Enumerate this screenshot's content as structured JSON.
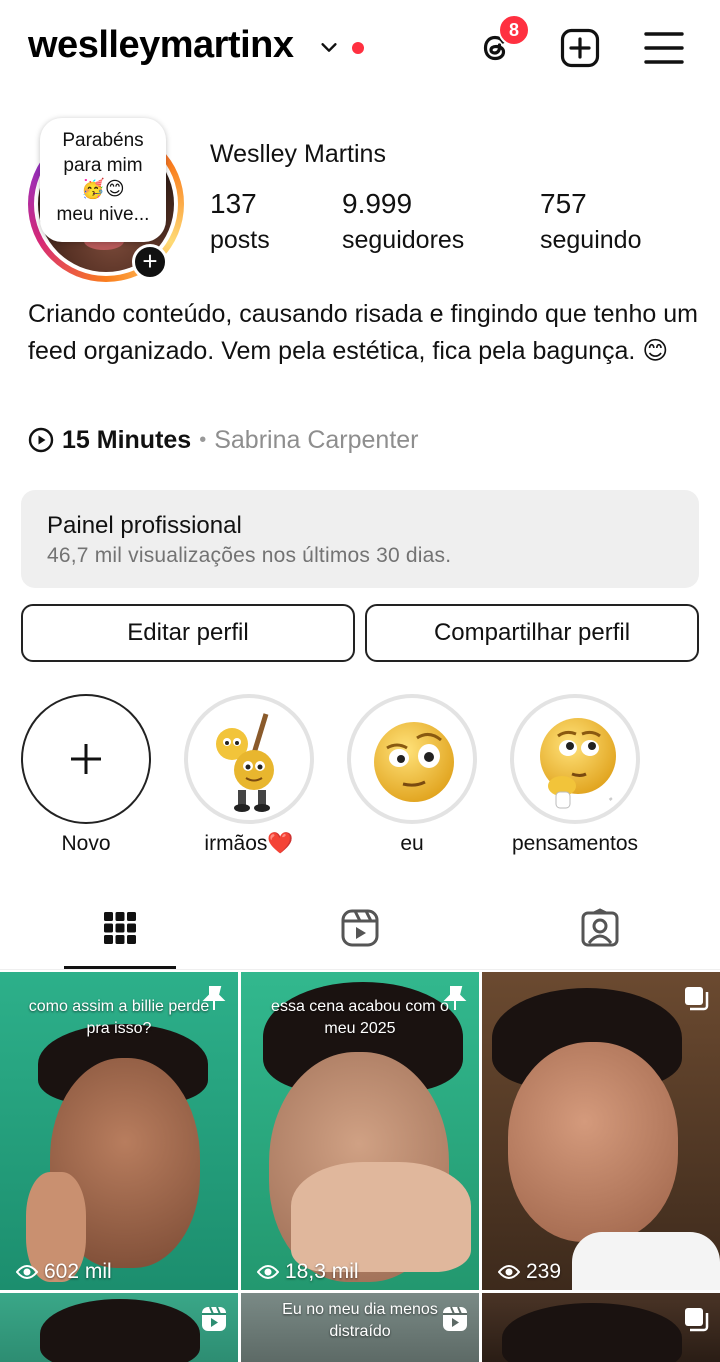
{
  "header": {
    "username": "weslleymartinx",
    "notifications_count": "8"
  },
  "profile": {
    "note": {
      "line1": "Parabéns",
      "line2": "para mim",
      "emojis": "🥳😊",
      "line3": "meu nive..."
    },
    "full_name": "Weslley Martins",
    "stats": [
      {
        "value": "137",
        "label": "posts"
      },
      {
        "value": "9.999",
        "label": "seguidores"
      },
      {
        "value": "757",
        "label": "seguindo"
      }
    ],
    "bio": "Criando conteúdo, causando risada e fingindo que tenho um feed organizado. Vem pela estética, fica pela bagunça. 😊",
    "music": {
      "title": "15 Minutes",
      "separator": "•",
      "artist": "Sabrina Carpenter"
    }
  },
  "professional_panel": {
    "title": "Painel profissional",
    "subtitle": "46,7 mil visualizações nos últimos 30 dias."
  },
  "buttons": {
    "edit": "Editar perfil",
    "share": "Compartilhar perfil"
  },
  "highlights": [
    {
      "label": "Novo"
    },
    {
      "label": "irmãos❤️"
    },
    {
      "label": "eu"
    },
    {
      "label": "pensamentos"
    }
  ],
  "tabs": [
    {
      "icon": "grid-icon"
    },
    {
      "icon": "reels-icon"
    },
    {
      "icon": "tagged-icon"
    }
  ],
  "posts": [
    {
      "caption": "como assim a billie perde pra isso?",
      "views": "602 mil",
      "icon": "pin-icon"
    },
    {
      "caption": "essa cena acabou com o meu 2025",
      "views": "18,3 mil",
      "icon": "pin-icon"
    },
    {
      "caption": "",
      "views": "239",
      "icon": "carousel-icon"
    },
    {
      "caption": "",
      "views": "",
      "icon": "reels-icon"
    },
    {
      "caption": "Eu no meu dia menos distraído",
      "views": "",
      "icon": "reels-icon"
    },
    {
      "caption": "",
      "views": "",
      "icon": "carousel-icon"
    }
  ]
}
